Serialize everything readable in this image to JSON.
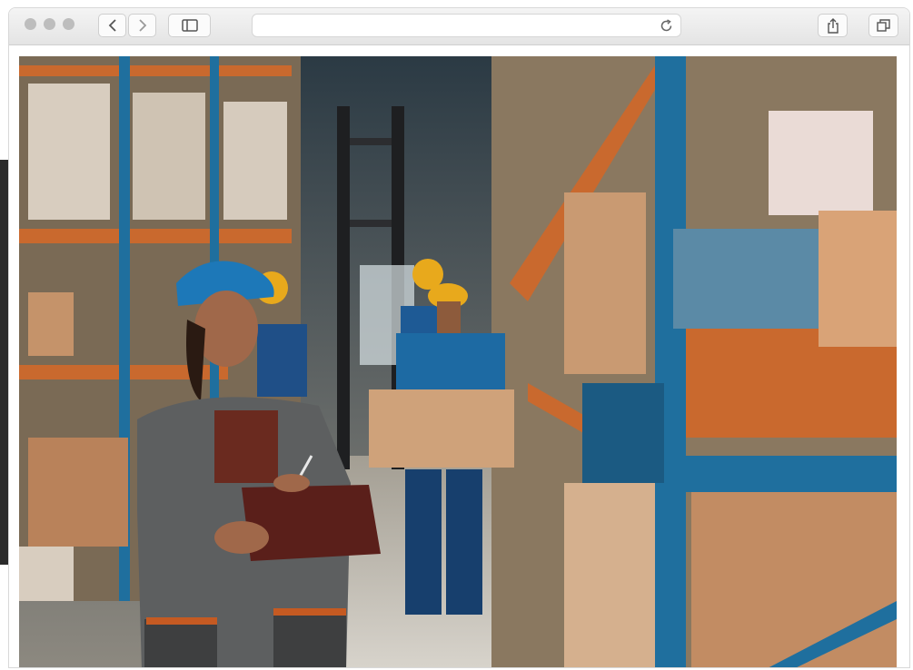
{
  "browser": {
    "url": "",
    "icons": [
      "back-arrow-icon",
      "forward-arrow-icon",
      "sidebar-icon",
      "reload-icon",
      "share-icon",
      "tabs-icon"
    ]
  },
  "colors": {
    "shelf_orange": "#c9692e",
    "rack_blue": "#1f6f9e",
    "hardhat_yellow": "#e8a91c",
    "hardhat_blue": "#1d78b8"
  }
}
